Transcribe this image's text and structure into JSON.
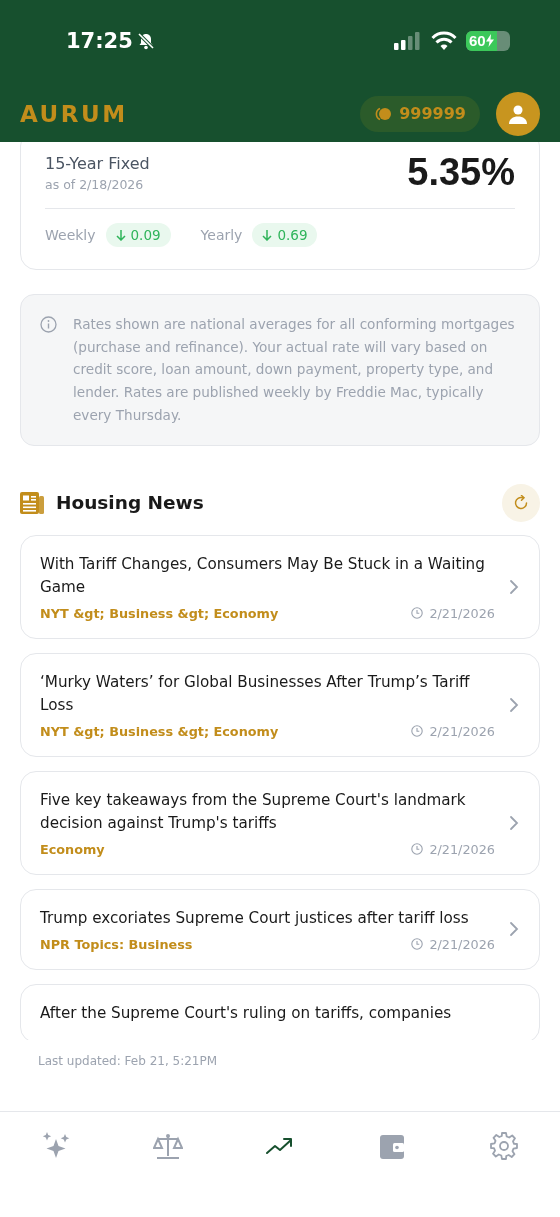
{
  "status_bar": {
    "time": "17:25",
    "silent": true,
    "battery": "60",
    "charging": true
  },
  "header": {
    "logo": "AURUM",
    "coins": "999999"
  },
  "rate_card": {
    "title": "15-Year Fixed",
    "as_of": "as of 2/18/2026",
    "rate": "5.35%",
    "changes": [
      {
        "label": "Weekly",
        "value": "0.09",
        "rising": false
      },
      {
        "label": "Yearly",
        "value": "0.69",
        "rising": false
      }
    ]
  },
  "info_note": "Rates shown are national averages for all conforming mortgages (purchase and refinance). Your actual rate will vary based on credit score, loan amount, down payment, property type, and lender. Rates are published weekly by Freddie Mac, typically every Thursday.",
  "news": {
    "title": "Housing News",
    "items": [
      {
        "headline": "With Tariff Changes, Consumers May Be Stuck in a Waiting Game",
        "source": "NYT &gt; Business &gt; Economy",
        "date": "2/21/2026"
      },
      {
        "headline": "‘Murky Waters’ for Global Businesses After Trump’s Tariff Loss",
        "source": "NYT &gt; Business &gt; Economy",
        "date": "2/21/2026"
      },
      {
        "headline": "Five key takeaways from the Supreme Court's landmark decision against Trump's tariffs",
        "source": "Economy",
        "date": "2/21/2026"
      },
      {
        "headline": "Trump excoriates Supreme Court justices after tariff loss",
        "source": "NPR Topics: Business",
        "date": "2/21/2026"
      },
      {
        "headline": "After the Supreme Court's ruling on tariffs, companies"
      }
    ],
    "last_updated": "Last updated: Feb 21, 5:21PM"
  },
  "tab_bar": [
    {
      "kind": "sparkles",
      "selected": false
    },
    {
      "kind": "scales",
      "selected": false
    },
    {
      "kind": "trend",
      "selected": true
    },
    {
      "kind": "wallet",
      "selected": false
    },
    {
      "kind": "settings",
      "selected": false
    }
  ]
}
